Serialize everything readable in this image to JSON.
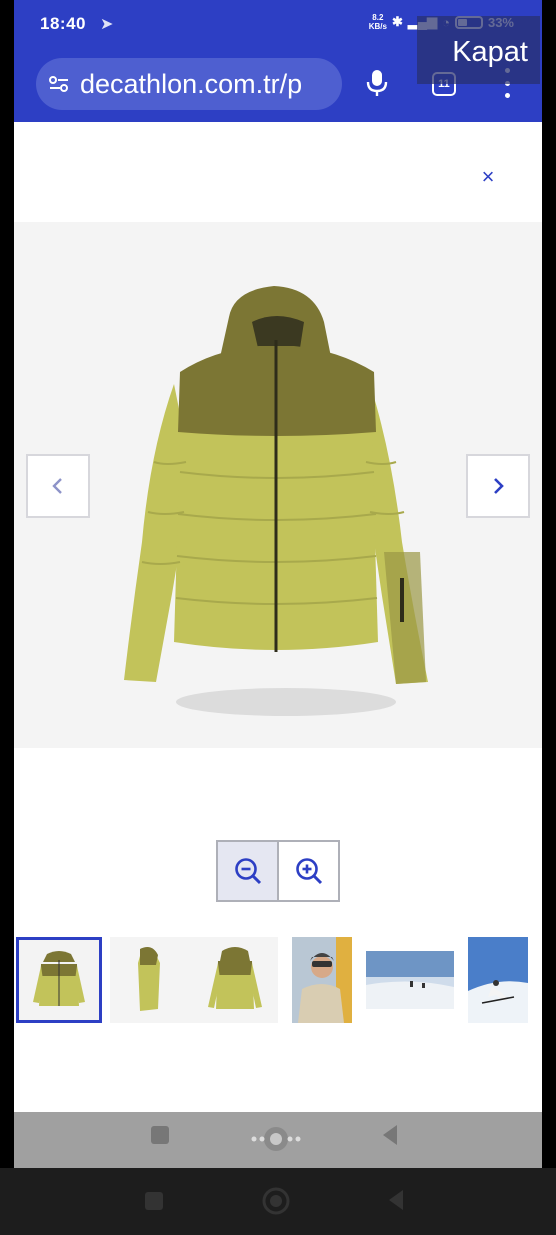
{
  "status_bar": {
    "time": "18:40",
    "net_speed": "8.2",
    "net_unit": "KB/s",
    "battery": "33"
  },
  "browser": {
    "url": "decathlon.com.tr/p",
    "tab_count": "11",
    "overlay_close_label": "Kapat"
  },
  "modal": {
    "close_symbol": "×",
    "thumbnails": [
      {
        "name": "jacket-front",
        "selected": true
      },
      {
        "name": "jacket-side",
        "selected": false
      },
      {
        "name": "jacket-back",
        "selected": false
      },
      {
        "name": "skier-portrait",
        "selected": false
      },
      {
        "name": "ski-slope-wide",
        "selected": false
      },
      {
        "name": "skier-action",
        "selected": false
      }
    ]
  },
  "colors": {
    "brand_blue": "#2d3fc4",
    "jacket_light": "#c2c35a",
    "jacket_dark": "#7c7634"
  },
  "icons": [
    "site-settings-icon",
    "mic-icon",
    "tabs-icon",
    "more-icon",
    "close-icon",
    "chevron-left-icon",
    "chevron-right-icon",
    "zoom-out-icon",
    "zoom-in-icon",
    "recents-icon",
    "home-icon",
    "back-icon"
  ]
}
